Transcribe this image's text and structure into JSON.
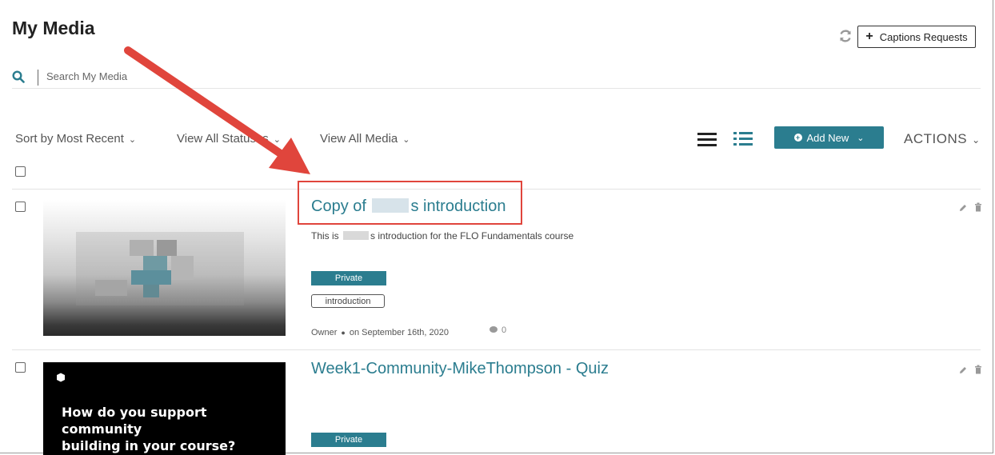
{
  "page": {
    "title": "My Media",
    "captions_button": "Captions Requests",
    "search_placeholder": "Search My Media"
  },
  "filters": {
    "sort": "Sort by Most Recent",
    "statuses": "View All Statuses",
    "media": "View All Media"
  },
  "toolbar": {
    "add_new": "Add New",
    "actions": "ACTIONS"
  },
  "items": [
    {
      "title_prefix": "Copy of ",
      "title_suffix": "s introduction",
      "desc_prefix": "This is ",
      "desc_suffix": "s introduction for the FLO Fundamentals course",
      "status": "Private",
      "tag": "introduction",
      "owner": "Owner",
      "date": "on September 16th, 2020",
      "comments": "0"
    },
    {
      "title": "Week1-Community-MikeThompson - Quiz",
      "thumbnail_text_line1": "How do you support community",
      "thumbnail_text_line2": "building in your course?",
      "status": "Private"
    }
  ],
  "colors": {
    "accent": "#2b7d8f",
    "highlight": "#e0453c",
    "annotation_arrow": "#e0453c"
  }
}
